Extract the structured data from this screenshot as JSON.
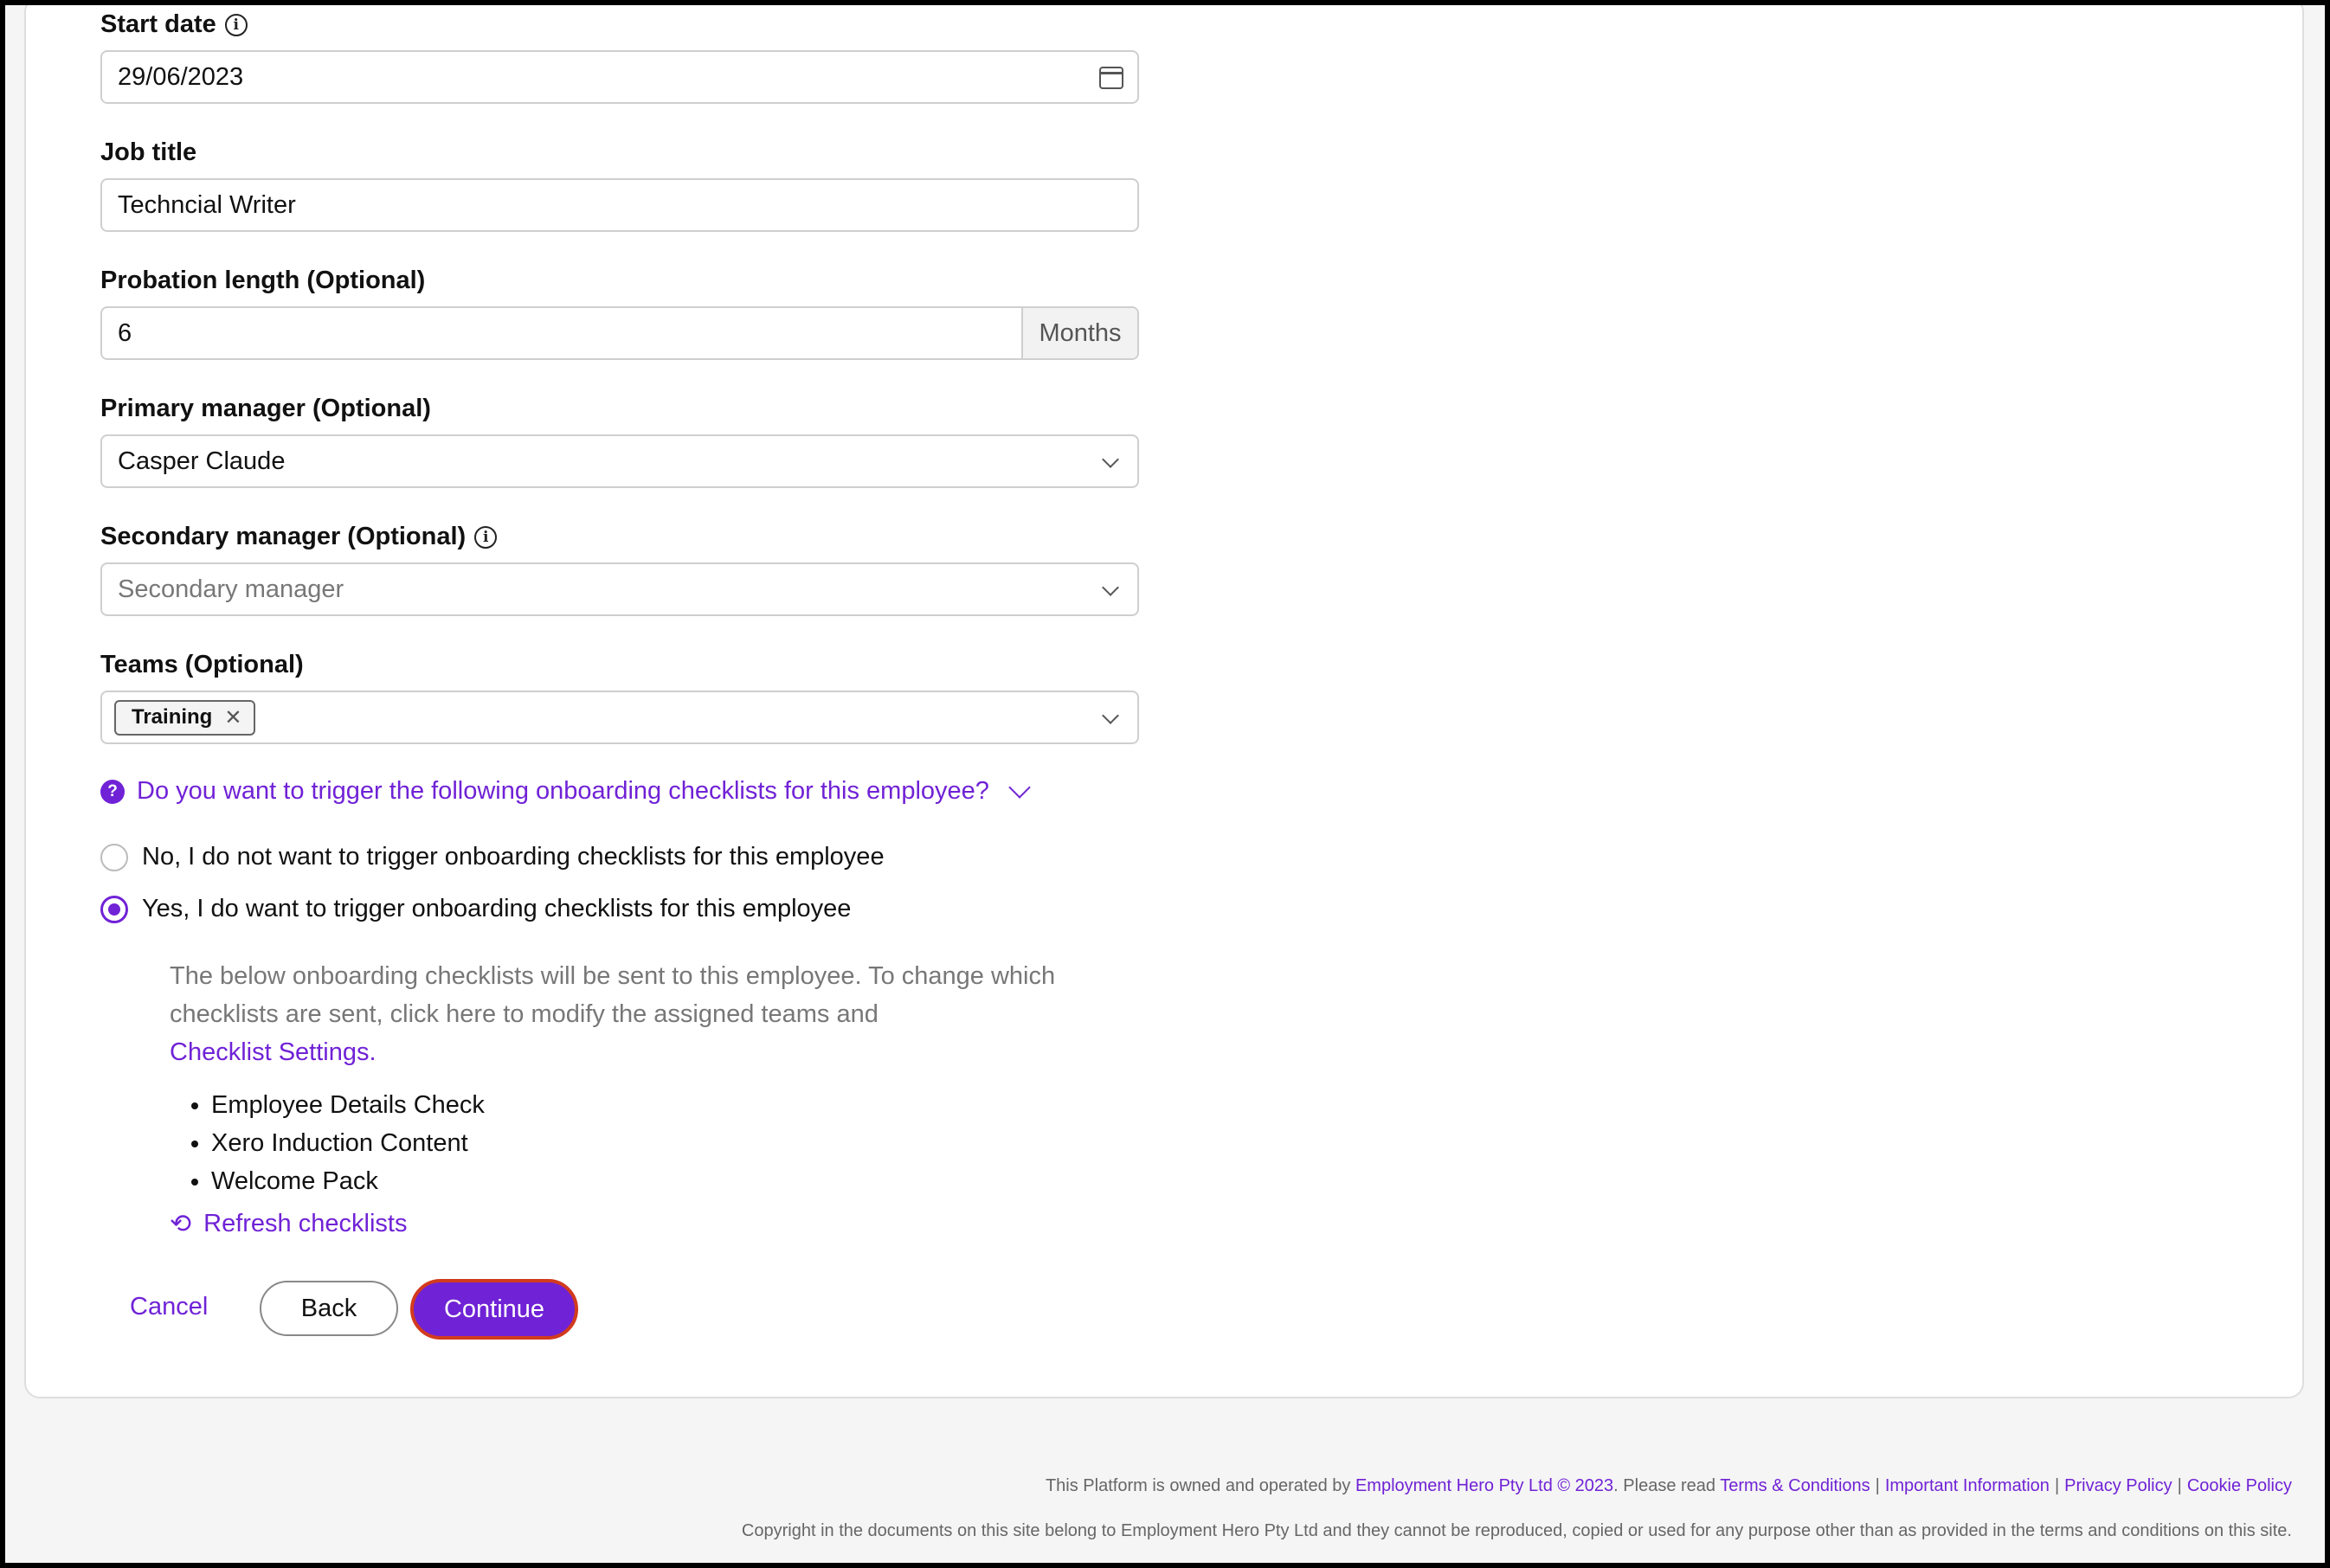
{
  "form": {
    "start_date": {
      "label": "Start date",
      "value": "29/06/2023"
    },
    "job_title": {
      "label": "Job title",
      "value": "Techncial Writer"
    },
    "probation": {
      "label": "Probation length (Optional)",
      "value": "6",
      "unit": "Months"
    },
    "primary_manager": {
      "label": "Primary manager (Optional)",
      "value": "Casper Claude"
    },
    "secondary_manager": {
      "label": "Secondary manager (Optional)",
      "placeholder": "Secondary manager"
    },
    "teams": {
      "label": "Teams (Optional)",
      "tags": [
        "Training"
      ]
    }
  },
  "onboarding": {
    "question": "Do you want to trigger the following onboarding checklists for this employee?",
    "option_no": "No, I do not want to trigger onboarding checklists for this employee",
    "option_yes": "Yes, I do want to trigger onboarding checklists for this employee",
    "selected": "yes",
    "description": "The below onboarding checklists will be sent to this employee. To change which checklists are sent, click here to modify the assigned teams and",
    "settings_link": "Checklist Settings.",
    "checklists": [
      "Employee Details Check",
      "Xero Induction Content",
      "Welcome Pack"
    ],
    "refresh_label": "Refresh checklists"
  },
  "actions": {
    "cancel": "Cancel",
    "back": "Back",
    "continue": "Continue"
  },
  "footer": {
    "line1_prefix": "This Platform is owned and operated by",
    "owner_link": "Employment Hero Pty Ltd © 2023",
    "line1_mid": ". Please read",
    "links": [
      "Terms & Conditions",
      "Important Information",
      "Privacy Policy",
      "Cookie Policy"
    ],
    "copyright": "Copyright in the documents on this site belong to Employment Hero Pty Ltd and they cannot be reproduced, copied or used for any purpose other than as provided in the terms and conditions on this site."
  },
  "colors": {
    "accent": "#7022d6",
    "focus_outline": "#d23b1e"
  }
}
